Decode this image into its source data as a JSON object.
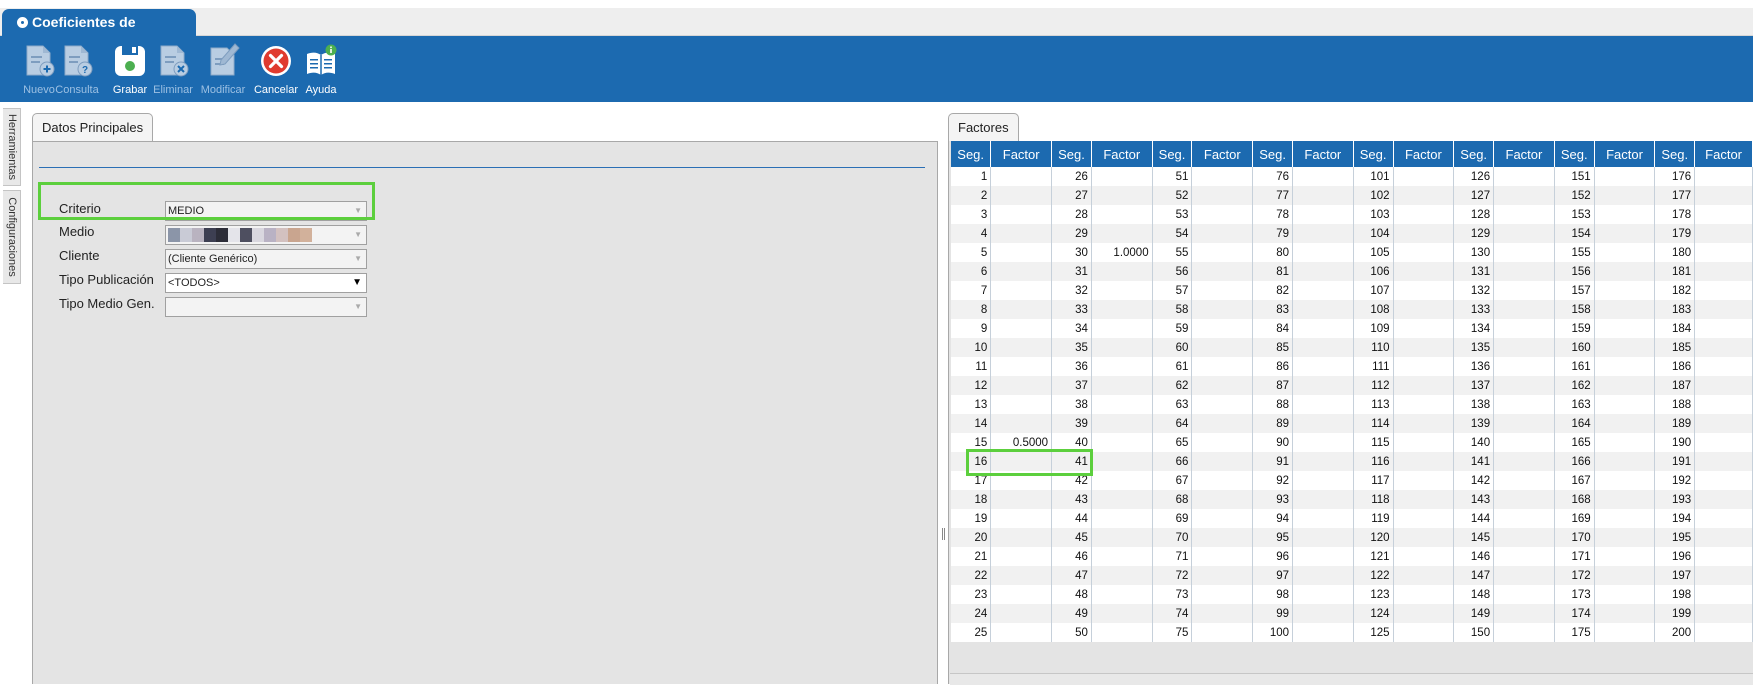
{
  "window_tab": {
    "title": "Coeficientes de Duración"
  },
  "toolbar": {
    "buttons": [
      {
        "id": "nuevo",
        "label": "Nuevo",
        "enabled": false,
        "icon": "document-add-icon"
      },
      {
        "id": "consulta",
        "label": "Consulta",
        "enabled": false,
        "icon": "document-query-icon"
      },
      {
        "id": "grabar",
        "label": "Grabar",
        "enabled": true,
        "icon": "floppy-disk-icon"
      },
      {
        "id": "eliminar",
        "label": "Eliminar",
        "enabled": false,
        "icon": "document-delete-icon"
      },
      {
        "id": "modificar",
        "label": "Modificar",
        "enabled": false,
        "icon": "document-edit-icon"
      },
      {
        "id": "cancelar",
        "label": "Cancelar",
        "enabled": true,
        "icon": "cancel-icon"
      },
      {
        "id": "ayuda",
        "label": "Ayuda",
        "enabled": true,
        "icon": "help-book-icon"
      }
    ]
  },
  "side_tabs": {
    "tools": "Herramientas",
    "config": "Configuraciones"
  },
  "left_panel": {
    "tab_label": "Datos Principales",
    "fields": {
      "criterio": {
        "label": "Criterio",
        "value": "MEDIO"
      },
      "medio": {
        "label": "Medio",
        "value": ""
      },
      "cliente": {
        "label": "Cliente",
        "value": "(Cliente Genérico)"
      },
      "tipo_publicacion": {
        "label": "Tipo Publicación",
        "value": "<TODOS>"
      },
      "tipo_medio_gen": {
        "label": "Tipo Medio Gen.",
        "value": ""
      }
    }
  },
  "right_panel": {
    "tab_label": "Factores",
    "columns": [
      "Seg.",
      "Factor",
      "Seg.",
      "Factor",
      "Seg.",
      "Factor",
      "Seg.",
      "Factor",
      "Seg.",
      "Factor",
      "Seg.",
      "Factor",
      "Seg.",
      "Factor",
      "Seg.",
      "Factor"
    ],
    "rows": [
      [
        "1",
        "",
        "26",
        "",
        "51",
        "",
        "76",
        "",
        "101",
        "",
        "126",
        "",
        "151",
        "",
        "176",
        ""
      ],
      [
        "2",
        "",
        "27",
        "",
        "52",
        "",
        "77",
        "",
        "102",
        "",
        "127",
        "",
        "152",
        "",
        "177",
        ""
      ],
      [
        "3",
        "",
        "28",
        "",
        "53",
        "",
        "78",
        "",
        "103",
        "",
        "128",
        "",
        "153",
        "",
        "178",
        ""
      ],
      [
        "4",
        "",
        "29",
        "",
        "54",
        "",
        "79",
        "",
        "104",
        "",
        "129",
        "",
        "154",
        "",
        "179",
        ""
      ],
      [
        "5",
        "",
        "30",
        "1.0000",
        "55",
        "",
        "80",
        "",
        "105",
        "",
        "130",
        "",
        "155",
        "",
        "180",
        ""
      ],
      [
        "6",
        "",
        "31",
        "",
        "56",
        "",
        "81",
        "",
        "106",
        "",
        "131",
        "",
        "156",
        "",
        "181",
        ""
      ],
      [
        "7",
        "",
        "32",
        "",
        "57",
        "",
        "82",
        "",
        "107",
        "",
        "132",
        "",
        "157",
        "",
        "182",
        ""
      ],
      [
        "8",
        "",
        "33",
        "",
        "58",
        "",
        "83",
        "",
        "108",
        "",
        "133",
        "",
        "158",
        "",
        "183",
        ""
      ],
      [
        "9",
        "",
        "34",
        "",
        "59",
        "",
        "84",
        "",
        "109",
        "",
        "134",
        "",
        "159",
        "",
        "184",
        ""
      ],
      [
        "10",
        "",
        "35",
        "",
        "60",
        "",
        "85",
        "",
        "110",
        "",
        "135",
        "",
        "160",
        "",
        "185",
        ""
      ],
      [
        "11",
        "",
        "36",
        "",
        "61",
        "",
        "86",
        "",
        "111",
        "",
        "136",
        "",
        "161",
        "",
        "186",
        ""
      ],
      [
        "12",
        "",
        "37",
        "",
        "62",
        "",
        "87",
        "",
        "112",
        "",
        "137",
        "",
        "162",
        "",
        "187",
        ""
      ],
      [
        "13",
        "",
        "38",
        "",
        "63",
        "",
        "88",
        "",
        "113",
        "",
        "138",
        "",
        "163",
        "",
        "188",
        ""
      ],
      [
        "14",
        "",
        "39",
        "",
        "64",
        "",
        "89",
        "",
        "114",
        "",
        "139",
        "",
        "164",
        "",
        "189",
        ""
      ],
      [
        "15",
        "0.5000",
        "40",
        "",
        "65",
        "",
        "90",
        "",
        "115",
        "",
        "140",
        "",
        "165",
        "",
        "190",
        ""
      ],
      [
        "16",
        "",
        "41",
        "",
        "66",
        "",
        "91",
        "",
        "116",
        "",
        "141",
        "",
        "166",
        "",
        "191",
        ""
      ],
      [
        "17",
        "",
        "42",
        "",
        "67",
        "",
        "92",
        "",
        "117",
        "",
        "142",
        "",
        "167",
        "",
        "192",
        ""
      ],
      [
        "18",
        "",
        "43",
        "",
        "68",
        "",
        "93",
        "",
        "118",
        "",
        "143",
        "",
        "168",
        "",
        "193",
        ""
      ],
      [
        "19",
        "",
        "44",
        "",
        "69",
        "",
        "94",
        "",
        "119",
        "",
        "144",
        "",
        "169",
        "",
        "194",
        ""
      ],
      [
        "20",
        "",
        "45",
        "",
        "70",
        "",
        "95",
        "",
        "120",
        "",
        "145",
        "",
        "170",
        "",
        "195",
        ""
      ],
      [
        "21",
        "",
        "46",
        "",
        "71",
        "",
        "96",
        "",
        "121",
        "",
        "146",
        "",
        "171",
        "",
        "196",
        ""
      ],
      [
        "22",
        "",
        "47",
        "",
        "72",
        "",
        "97",
        "",
        "122",
        "",
        "147",
        "",
        "172",
        "",
        "197",
        ""
      ],
      [
        "23",
        "",
        "48",
        "",
        "73",
        "",
        "98",
        "",
        "123",
        "",
        "148",
        "",
        "173",
        "",
        "198",
        ""
      ],
      [
        "24",
        "",
        "49",
        "",
        "74",
        "",
        "99",
        "",
        "124",
        "",
        "149",
        "",
        "174",
        "",
        "199",
        ""
      ],
      [
        "25",
        "",
        "50",
        "",
        "75",
        "",
        "100",
        "",
        "125",
        "",
        "150",
        "",
        "175",
        "",
        "200",
        ""
      ]
    ]
  },
  "colors": {
    "brand_blue": "#1c6ab0",
    "highlight_green": "#5ccf3d",
    "panel_gray": "#e4e4e4",
    "cancel_red": "#e03b2f"
  }
}
